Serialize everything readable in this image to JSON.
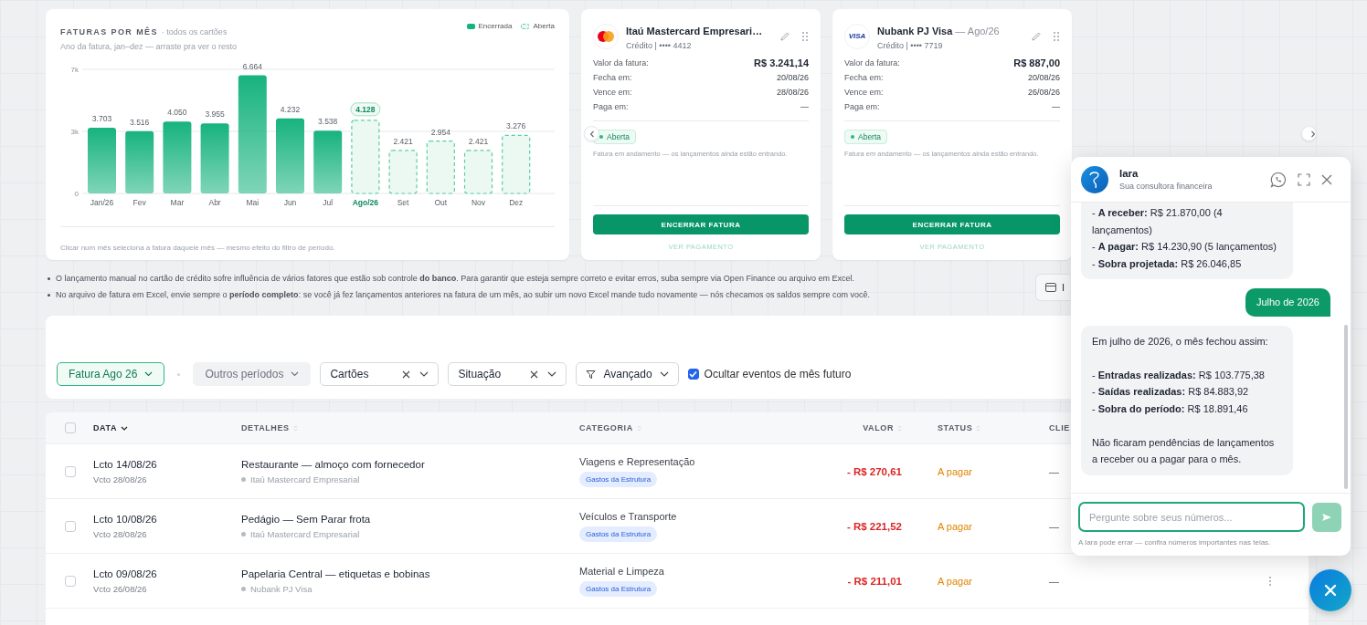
{
  "chart_card": {
    "title": "FATURAS POR MÊS",
    "scope": "· todos os cartões",
    "subtitle": "Ano da fatura, jan–dez — arraste pra ver o resto",
    "footnote": "Clicar num mês seleciona a fatura daquele mês — mesmo efeito do filtro de período.",
    "chart_data": {
      "type": "bar",
      "categories": [
        "Jan/26",
        "Fev",
        "Mar",
        "Abr",
        "Mai",
        "Jun",
        "Jul",
        "Ago/26",
        "Set",
        "Out",
        "Nov",
        "Dez"
      ],
      "series": [
        {
          "name": "Encerrada",
          "color": "#17b37e",
          "values": [
            3703,
            3516,
            4050,
            3955,
            6664,
            4232,
            3538,
            null,
            null,
            null,
            null,
            null
          ]
        },
        {
          "name": "Aberta",
          "color": "#5ccfa3",
          "values": [
            null,
            null,
            null,
            null,
            null,
            null,
            null,
            4128,
            2421,
            2954,
            2421,
            3276
          ]
        }
      ],
      "ylim": [
        0,
        7000
      ],
      "yticks": [
        {
          "value": 0,
          "label": "0"
        },
        {
          "value": 3500,
          "label": "3k"
        },
        {
          "value": 7000,
          "label": "7k"
        }
      ],
      "value_labels": [
        "3.703",
        "3.516",
        "4.050",
        "3.955",
        "6.664",
        "4.232",
        "3.538",
        "4.128",
        "2.421",
        "2.954",
        "2.421",
        "3.276"
      ]
    }
  },
  "invoice_cards": [
    {
      "brand": {
        "kind": "mastercard"
      },
      "title": "Itaú Mastercard Empresari…",
      "subtitle": "Crédito | •••• 4412",
      "rows": [
        {
          "label": "Valor da fatura:",
          "value": "R$ 3.241,14"
        },
        {
          "label": "Fecha em:",
          "value": "20/08/26"
        },
        {
          "label": "Vence em:",
          "value": "28/08/26"
        },
        {
          "label": "Paga em:",
          "value": "—"
        }
      ],
      "status": "Aberta",
      "note": "Fatura em andamento — os lançamentos ainda estão entrando.",
      "primary_button": "ENCERRAR FATURA",
      "link": "VER PAGAMENTO"
    },
    {
      "brand": {
        "kind": "visa",
        "label": "VISA"
      },
      "title": "Nubank PJ Visa",
      "period": "— Ago/26",
      "subtitle": "Crédito | •••• 7719",
      "rows": [
        {
          "label": "Valor da fatura:",
          "value": "R$ 887,00"
        },
        {
          "label": "Fecha em:",
          "value": "20/08/26"
        },
        {
          "label": "Vence em:",
          "value": "26/08/26"
        },
        {
          "label": "Paga em:",
          "value": "—"
        }
      ],
      "status": "Aberta",
      "note": "Fatura em andamento — os lançamentos ainda estão entrando.",
      "primary_button": "ENCERRAR FATURA",
      "link": "VER PAGAMENTO"
    }
  ],
  "notes": [
    "O lançamento manual no cartão de crédito sofre influência de vários fatores que estão sob controle **do banco**. Para garantir que esteja sempre correto e evitar erros, suba sempre via Open Finance ou arquivo em Excel.",
    "No arquivo de fatura em Excel, envie sempre o **período completo**: se você já fez lançamentos anteriores na fatura de um mês, ao subir um novo Excel mande tudo novamente — nós checamos os saldos sempre com você."
  ],
  "import_button": "I",
  "filters": [
    {
      "kind": "pill",
      "label": "Fatura Ago 26",
      "selected": true
    },
    {
      "kind": "pill",
      "label": "Outros períodos",
      "selected": false
    },
    {
      "kind": "select",
      "label": "Cartões",
      "clearable": true
    },
    {
      "kind": "select",
      "label": "Situação",
      "clearable": true
    },
    {
      "kind": "menu",
      "label": "Avançado"
    },
    {
      "kind": "checkbox",
      "label": "Ocultar eventos de mês futuro",
      "checked": true
    }
  ],
  "table": {
    "all_checked": false,
    "columns": [
      {
        "label": "DATA",
        "sorted": true
      },
      {
        "label": "DETALHES",
        "sorted": false
      },
      {
        "label": "CATEGORIA",
        "sorted": false
      },
      {
        "label": "VALOR",
        "sorted": false
      },
      {
        "label": "STATUS",
        "sorted": false
      },
      {
        "label": "CLIE"
      }
    ],
    "rows": [
      {
        "checked": false,
        "date": "Lcto 14/08/26",
        "due": "Vcto 28/08/26",
        "title": "Restaurante — almoço com fornecedor",
        "card": "Itaú Mastercard Empresarial",
        "category": "Viagens e Representação",
        "tag": "Gastos da Estrutura",
        "value": "- R$ 270,61",
        "status": "A pagar",
        "client": "—"
      },
      {
        "checked": false,
        "date": "Lcto 10/08/26",
        "due": "Vcto 28/08/26",
        "title": "Pedágio — Sem Parar frota",
        "card": "Itaú Mastercard Empresarial",
        "category": "Veículos e Transporte",
        "tag": "Gastos da Estrutura",
        "value": "- R$ 221,52",
        "status": "A pagar",
        "client": "—"
      },
      {
        "checked": false,
        "date": "Lcto 09/08/26",
        "due": "Vcto 26/08/26",
        "title": "Papelaria Central — etiquetas e bobinas",
        "card": "Nubank PJ Visa",
        "category": "Material e Limpeza",
        "tag": "Gastos da Estrutura",
        "value": "- R$ 211,01",
        "status": "A pagar",
        "client": "—"
      }
    ]
  },
  "chat": {
    "name": "Iara",
    "role": "Sua consultora financeira",
    "messages": [
      {
        "kind": "assistant",
        "paragraphs": [
          [
            "- **A receber:** R$ 21.870,00 (4 lançamentos)",
            "- **A pagar:** R$ 14.230,90 (5 lançamentos)",
            "- **Sobra projetada:** R$ 26.046,85"
          ]
        ]
      },
      {
        "kind": "user",
        "paragraphs": [
          [
            "Julho de 2026"
          ]
        ]
      },
      {
        "kind": "assistant",
        "paragraphs": [
          [
            "Em julho de 2026, o mês fechou assim:"
          ],
          [
            "- **Entradas realizadas:** R$ 103.775,38",
            "- **Saídas realizadas:** R$ 84.883,92",
            "- **Sobra do período:** R$ 18.891,46"
          ],
          [
            "Não ficaram pendências de lançamentos a receber ou a pagar para o mês."
          ]
        ]
      }
    ],
    "input_placeholder": "Pergunte sobre seus números...",
    "disclaimer": "A Iara pode errar — confira números importantes nas telas."
  }
}
